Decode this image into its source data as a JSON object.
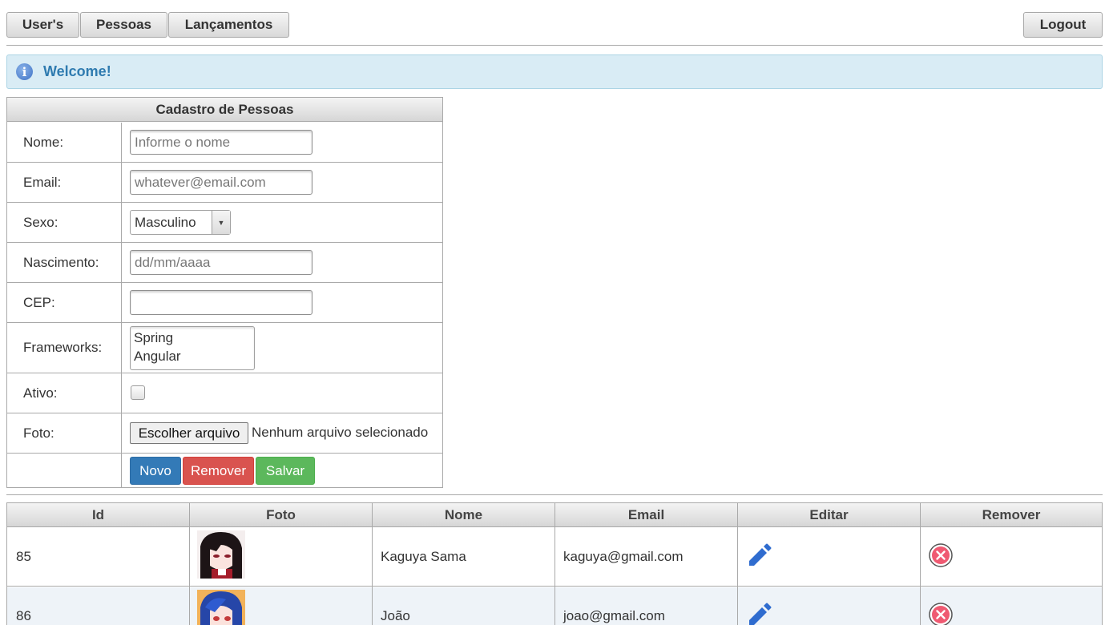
{
  "nav": {
    "users_label": "User's",
    "pessoas_label": "Pessoas",
    "lancamentos_label": "Lançamentos",
    "logout_label": "Logout"
  },
  "message": {
    "text": "Welcome!"
  },
  "form": {
    "title": "Cadastro de Pessoas",
    "nome_label": "Nome:",
    "nome_placeholder": "Informe o nome",
    "email_label": "Email:",
    "email_placeholder": "whatever@email.com",
    "sexo_label": "Sexo:",
    "sexo_value": "Masculino",
    "nascimento_label": "Nascimento:",
    "nascimento_placeholder": "dd/mm/aaaa",
    "cep_label": "CEP:",
    "cep_value": "",
    "frameworks_label": "Frameworks:",
    "frameworks_options": [
      "Spring",
      "Angular"
    ],
    "ativo_label": "Ativo:",
    "ativo_checked": false,
    "foto_label": "Foto:",
    "file_button_label": "Escolher arquivo",
    "file_status": "Nenhum arquivo selecionado",
    "novo_label": "Novo",
    "remover_label": "Remover",
    "salvar_label": "Salvar"
  },
  "table": {
    "headers": [
      "Id",
      "Foto",
      "Nome",
      "Email",
      "Editar",
      "Remover"
    ],
    "rows": [
      {
        "id": "85",
        "nome": "Kaguya Sama",
        "email": "kaguya@gmail.com"
      },
      {
        "id": "86",
        "nome": "João",
        "email": "joao@gmail.com"
      }
    ]
  },
  "colors": {
    "novo": "#337ab7",
    "remover": "#d9534f",
    "salvar": "#5cb85c",
    "welcome_bg": "#d9ecf5",
    "welcome_text": "#2f7bb0",
    "row_alt": "#eef3f8",
    "edit_icon": "#2f6ccf",
    "remove_icon": "#ef5a72"
  }
}
